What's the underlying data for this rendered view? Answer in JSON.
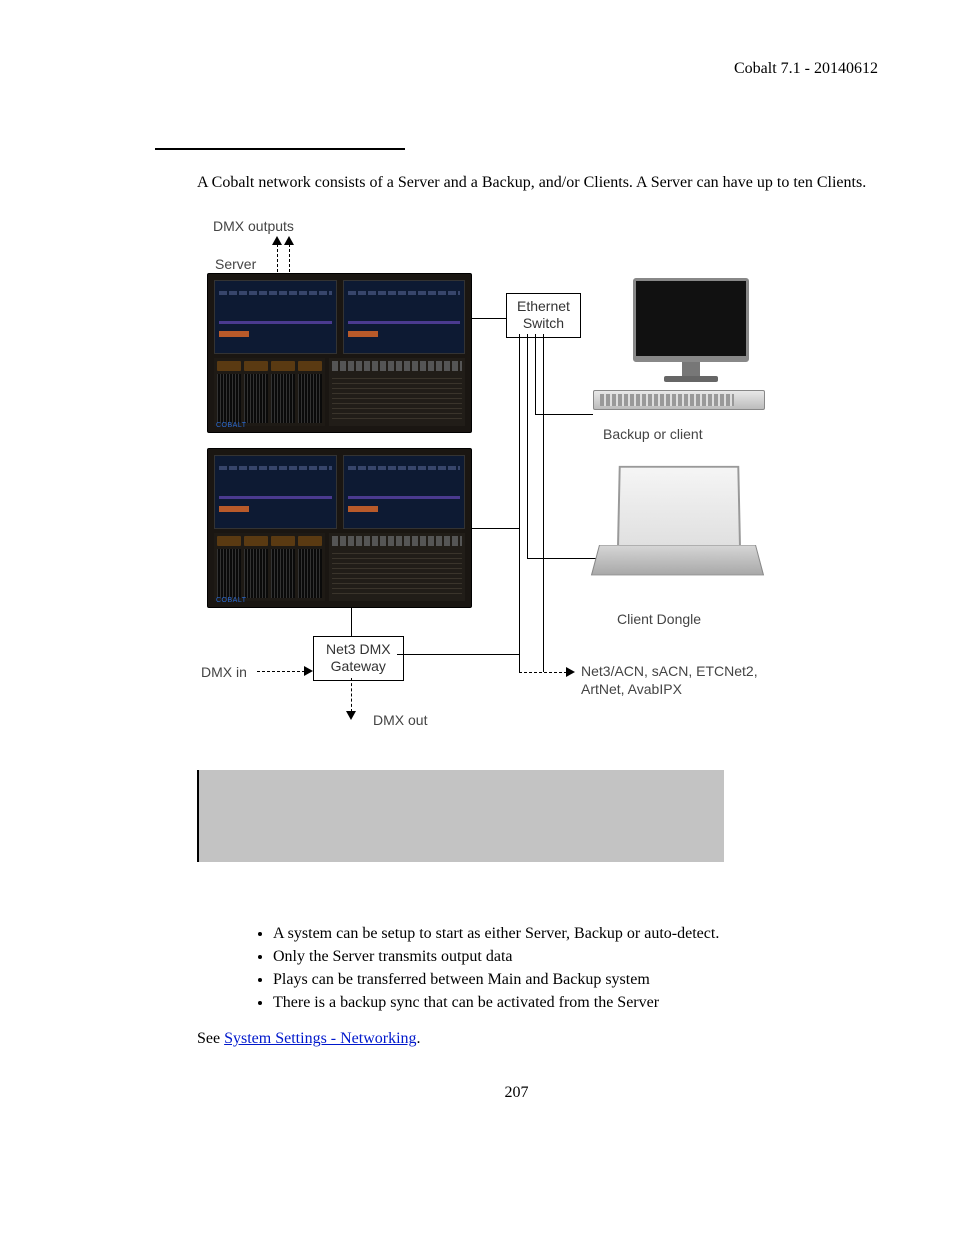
{
  "header": {
    "product_version": "Cobalt 7.1 - 20140612"
  },
  "intro": "A Cobalt network consists of a Server and a Backup, and/or Clients. A Server can have up to ten Clients.",
  "diagram": {
    "dmx_outputs": "DMX outputs",
    "server": "Server",
    "ethernet_switch_line1": "Ethernet",
    "ethernet_switch_line2": "Switch",
    "backup_or_client": "Backup or client",
    "client_dongle": "Client Dongle",
    "net3_gateway_line1": "Net3 DMX",
    "net3_gateway_line2": "Gateway",
    "dmx_in": "DMX in",
    "dmx_out": "DMX out",
    "protocols_line1": "Net3/ACN, sACN, ETCNet2,",
    "protocols_line2": "ArtNet, AvabIPX",
    "console_brand": "COBALT"
  },
  "bullets": [
    "A system can be setup to start as either Server, Backup or auto-detect.",
    "Only the Server transmits output data",
    "Plays can be transferred between Main and Backup system",
    "There is a backup sync that can be activated from the Server"
  ],
  "see": {
    "prefix": "See ",
    "link": "System Settings - Networking",
    "suffix": "."
  },
  "page_number": "207"
}
